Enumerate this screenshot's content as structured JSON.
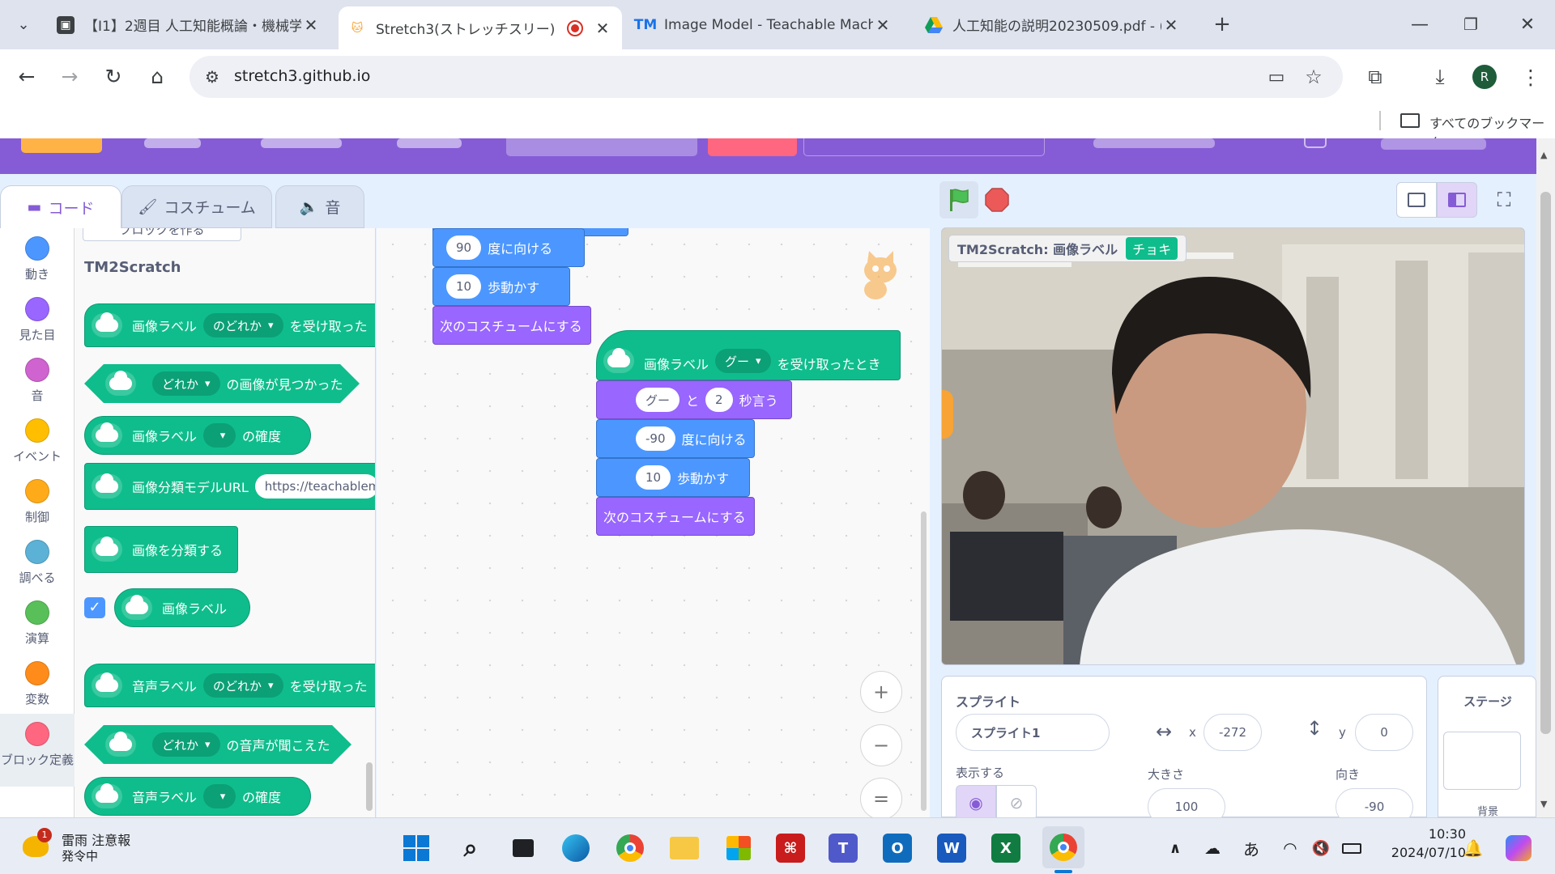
{
  "browser": {
    "tabs": [
      {
        "title": "【I1】2週目 人工知能概論・機械学",
        "favicon": "classroom-icon"
      },
      {
        "title": "Stretch3(ストレッチスリー)",
        "favicon": "scratch-cat-icon",
        "recording": true
      },
      {
        "title": "Image Model - Teachable Mach",
        "favicon": "TM"
      },
      {
        "title": "人工知能の説明20230509.pdf - (",
        "favicon": "drive-icon"
      }
    ],
    "url": "stretch3.github.io",
    "profile_initial": "R",
    "bookmarks_label": "すべてのブックマーク"
  },
  "editor": {
    "tabs": {
      "code": "コード",
      "costume": "コスチューム",
      "sound": "音"
    },
    "categories": [
      {
        "label": "動き",
        "color": "#4c97ff"
      },
      {
        "label": "見た目",
        "color": "#9966ff"
      },
      {
        "label": "音",
        "color": "#cf63cf"
      },
      {
        "label": "イベント",
        "color": "#ffbf00"
      },
      {
        "label": "制御",
        "color": "#ffab19"
      },
      {
        "label": "調べる",
        "color": "#5cb1d6"
      },
      {
        "label": "演算",
        "color": "#59c059"
      },
      {
        "label": "変数",
        "color": "#ff8c1a"
      },
      {
        "label": "ブロック定義",
        "color": "#ff6680"
      }
    ],
    "palette": {
      "make_block_partial": "ブロックを作る",
      "section_title": "TM2Scratch",
      "b1_a": "画像ラベル",
      "b1_dd": "のどれか",
      "b1_b": "を受け取った",
      "b2_dd": "どれか",
      "b2_b": "の画像が見つかった",
      "b3_a": "画像ラベル",
      "b3_b": "の確度",
      "b4_a": "画像分類モデルURL",
      "b4_input": "https://teachablem",
      "b5_a": "画像を分類する",
      "b6_a": "画像ラベル",
      "b7_a": "音声ラベル",
      "b7_dd": "のどれか",
      "b7_b": "を受け取った",
      "b8_dd": "どれか",
      "b8_b": "の音声が聞こえた",
      "b9_a": "音声ラベル",
      "b9_b": "の確度"
    },
    "script1": {
      "turn_value": "90",
      "turn_label": "度に向ける",
      "move_value": "10",
      "move_label": "歩動かす",
      "costume_label": "次のコスチュームにする"
    },
    "script2": {
      "hat_a": "画像ラベル",
      "hat_dd": "グー",
      "hat_b": "を受け取ったとき",
      "say_text": "グー",
      "say_and": "と",
      "say_secs": "2",
      "say_label": "秒言う",
      "turn_value": "-90",
      "turn_label": "度に向ける",
      "move_value": "10",
      "move_label": "歩動かす",
      "costume_label": "次のコスチュームにする"
    },
    "zoom": {
      "in": "+",
      "out": "−",
      "reset": "="
    }
  },
  "stage": {
    "monitor_label": "TM2Scratch: 画像ラベル",
    "monitor_value": "チョキ"
  },
  "sprite_info": {
    "title": "スプライト",
    "name": "スプライト1",
    "x_label": "x",
    "x": "-272",
    "y_label": "y",
    "y": "0",
    "show_label": "表示する",
    "size_label": "大きさ",
    "size": "100",
    "direction_label": "向き",
    "direction": "-90",
    "stage_label": "ステージ",
    "backdrop_partial": "背景"
  },
  "taskbar": {
    "weather_title": "雷雨 注意報",
    "weather_sub": "発令中",
    "weather_badge": "1",
    "time": "10:30",
    "date": "2024/07/10",
    "ime": "あ"
  }
}
